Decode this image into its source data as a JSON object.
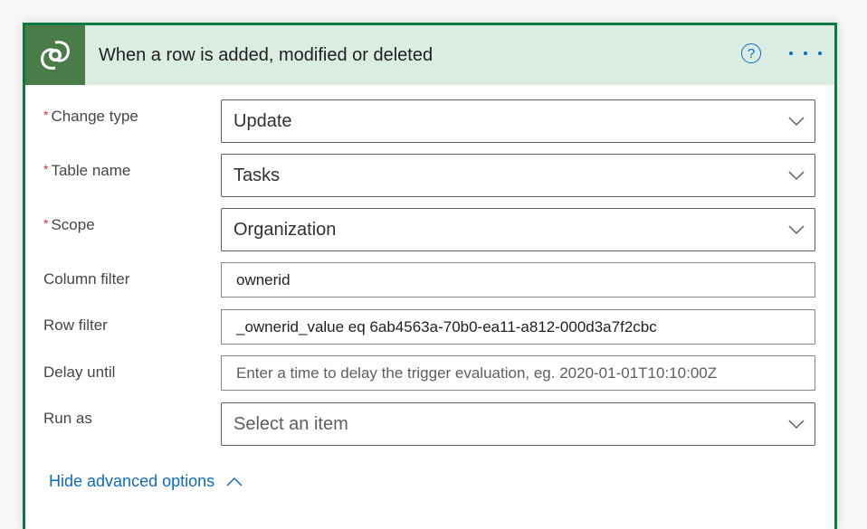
{
  "header": {
    "title": "When a row is added, modified or deleted",
    "icon": "dataverse-icon",
    "help_icon": "?",
    "more_icon": "more-options-icon"
  },
  "fields": [
    {
      "label": "Change type",
      "required": true,
      "type": "select",
      "value": "Update"
    },
    {
      "label": "Table name",
      "required": true,
      "type": "select",
      "value": "Tasks"
    },
    {
      "label": "Scope",
      "required": true,
      "type": "select",
      "value": "Organization"
    },
    {
      "label": "Column filter",
      "required": false,
      "type": "text",
      "value": "ownerid"
    },
    {
      "label": "Row filter",
      "required": false,
      "type": "text",
      "value": "_ownerid_value eq 6ab4563a-70b0-ea11-a812-000d3a7f2cbc"
    },
    {
      "label": "Delay until",
      "required": false,
      "type": "text",
      "value": "",
      "placeholder": "Enter a time to delay the trigger evaluation, eg. 2020-01-01T10:10:00Z"
    },
    {
      "label": "Run as",
      "required": false,
      "type": "select",
      "value": "",
      "placeholder": "Select an item"
    }
  ],
  "required_marker": "*",
  "advanced_toggle": {
    "label": "Hide advanced options"
  },
  "colors": {
    "accent": "#0f6cbd",
    "border": "#0b7a3e",
    "header_bg": "#dbece3",
    "icon_bg": "#497c48"
  }
}
